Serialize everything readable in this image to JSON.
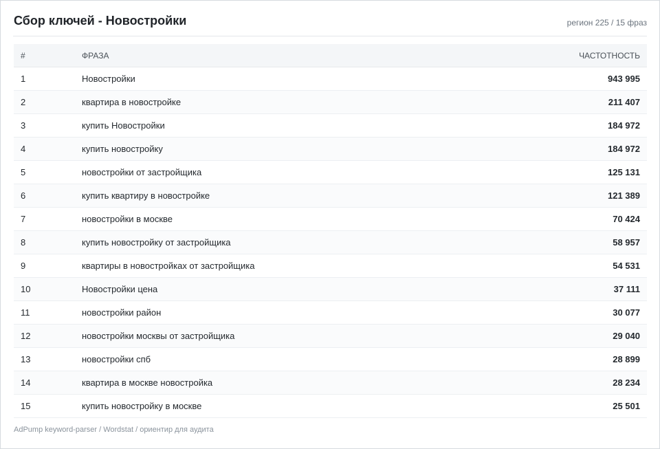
{
  "header": {
    "title": "Сбор ключей - Новостройки",
    "meta": "регион 225 / 15 фраз"
  },
  "table": {
    "columns": {
      "num": "#",
      "phrase": "ФРАЗА",
      "freq": "ЧАСТОТНОСТЬ"
    },
    "rows": [
      {
        "num": "1",
        "phrase": "Новостройки",
        "freq": "943 995"
      },
      {
        "num": "2",
        "phrase": "квартира в новостройке",
        "freq": "211 407"
      },
      {
        "num": "3",
        "phrase": "купить Новостройки",
        "freq": "184 972"
      },
      {
        "num": "4",
        "phrase": "купить новостройку",
        "freq": "184 972"
      },
      {
        "num": "5",
        "phrase": "новостройки от застройщика",
        "freq": "125 131"
      },
      {
        "num": "6",
        "phrase": "купить квартиру в новостройке",
        "freq": "121 389"
      },
      {
        "num": "7",
        "phrase": "новостройки в москве",
        "freq": "70 424"
      },
      {
        "num": "8",
        "phrase": "купить новостройку от застройщика",
        "freq": "58 957"
      },
      {
        "num": "9",
        "phrase": "квартиры в новостройках от застройщика",
        "freq": "54 531"
      },
      {
        "num": "10",
        "phrase": "Новостройки цена",
        "freq": "37 111"
      },
      {
        "num": "11",
        "phrase": "новостройки район",
        "freq": "30 077"
      },
      {
        "num": "12",
        "phrase": "новостройки москвы от застройщика",
        "freq": "29 040"
      },
      {
        "num": "13",
        "phrase": "новостройки спб",
        "freq": "28 899"
      },
      {
        "num": "14",
        "phrase": "квартира в москве новостройка",
        "freq": "28 234"
      },
      {
        "num": "15",
        "phrase": "купить новостройку в москве",
        "freq": "25 501"
      }
    ]
  },
  "footer": {
    "text": "AdPump keyword-parser / Wordstat / ориентир для аудита"
  }
}
